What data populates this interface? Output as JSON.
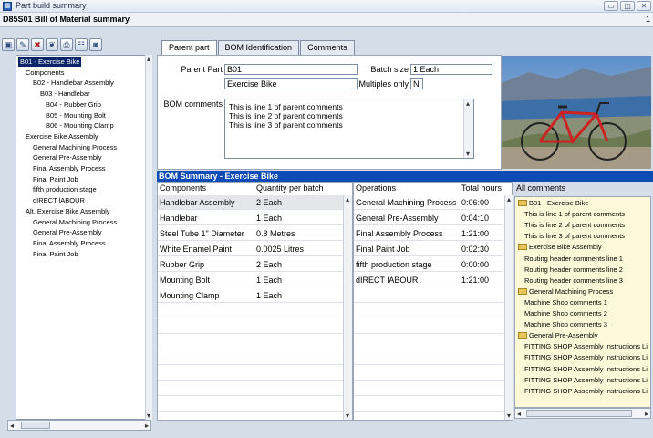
{
  "window": {
    "title": "Part build summary",
    "subtitle": "D85S01 Bill of Material summary",
    "page_number": "1"
  },
  "toolbar": {
    "icons": [
      "open-folder-icon",
      "edit-icon",
      "delete-icon",
      "tree-icon",
      "print-icon",
      "structure-icon",
      "photo-icon"
    ]
  },
  "tree": {
    "items": [
      {
        "label": "B01 - Exercise Bike",
        "selected": true
      },
      {
        "label": "Components"
      },
      {
        "label": "B02 - Handlebar Assembly"
      },
      {
        "label": "B03 - Handlebar"
      },
      {
        "label": "B04 - Rubber Grip"
      },
      {
        "label": "B05 - Mounting Bolt"
      },
      {
        "label": "B06 - Mounting Clamp"
      },
      {
        "label": "Exercise Bike Assembly"
      },
      {
        "label": "General Machining Process"
      },
      {
        "label": "General Pre-Assembly"
      },
      {
        "label": "Final Assembly Process"
      },
      {
        "label": "Final Paint Job"
      },
      {
        "label": "fifth production stage"
      },
      {
        "label": "dIRECT lABOUR"
      },
      {
        "label": "Alt. Exercise Bike Assembly"
      },
      {
        "label": "General Machining Process"
      },
      {
        "label": "General Pre-Assembly"
      },
      {
        "label": "Final Assembly Process"
      },
      {
        "label": "Final Paint Job"
      }
    ]
  },
  "tabs": [
    "Parent part",
    "BOM Identification",
    "Comments"
  ],
  "parent": {
    "parent_part_label": "Parent Part",
    "parent_part_value": "B01",
    "description": "Exercise Bike",
    "batch_size_label": "Batch size",
    "batch_size_value": "1 Each",
    "multiples_label": "Multiples only",
    "multiples_value": "N",
    "bom_comments_label": "BOM comments",
    "bom_comments": [
      "This is line 1 of parent comments",
      "This is line 2 of parent comments",
      "This is line 3 of parent comments"
    ]
  },
  "bom_summary": {
    "title": "BOM Summary -  Exercise Bike",
    "components_header": "Components",
    "qty_header": "Quantity per batch",
    "operations_header": "Operations",
    "hours_header": "Total hours",
    "all_comments_header": "All comments",
    "components": [
      {
        "name": "Handlebar Assembly",
        "qty": "2 Each"
      },
      {
        "name": "Handlebar",
        "qty": "1 Each"
      },
      {
        "name": "Steel Tube 1\" Diameter",
        "qty": "0.8 Metres"
      },
      {
        "name": "White Enamel Paint",
        "qty": "0.0025 Litres"
      },
      {
        "name": "Rubber Grip",
        "qty": "2 Each"
      },
      {
        "name": "Mounting Bolt",
        "qty": "1 Each"
      },
      {
        "name": "Mounting Clamp",
        "qty": "1 Each"
      }
    ],
    "operations": [
      {
        "name": "General Machining Process",
        "hours": "0:06:00"
      },
      {
        "name": "General Pre-Assembly",
        "hours": "0:04:10"
      },
      {
        "name": "Final Assembly Process",
        "hours": "1:21:00"
      },
      {
        "name": "Final Paint Job",
        "hours": "0:02:30"
      },
      {
        "name": "fifth production stage",
        "hours": "0:00:00"
      },
      {
        "name": "dIRECT lABOUR",
        "hours": "1:21:00"
      }
    ],
    "all_comments": [
      {
        "text": "B01 - Exercise Bike",
        "folder": true
      },
      {
        "text": "This is line 1 of parent comments"
      },
      {
        "text": "This is line 2 of parent comments"
      },
      {
        "text": "This is line 3 of parent comments"
      },
      {
        "text": "Exercise Bike Assembly",
        "folder": true
      },
      {
        "text": "Routing header comments line 1"
      },
      {
        "text": "Routing header comments line 2"
      },
      {
        "text": "Routing header comments line 3"
      },
      {
        "text": "General Machining Process",
        "folder": true
      },
      {
        "text": "Machine Shop comments 1"
      },
      {
        "text": "Machine Shop comments 2"
      },
      {
        "text": "Machine Shop comments 3"
      },
      {
        "text": "General Pre-Assembly",
        "folder": true
      },
      {
        "text": "FITTING SHOP Assembly Instructions Li"
      },
      {
        "text": "FITTING SHOP Assembly Instructions Li"
      },
      {
        "text": "FITTING SHOP Assembly Instructions Li"
      },
      {
        "text": "FITTING SHOP Assembly Instructions Li"
      },
      {
        "text": "FITTING SHOP Assembly Instructions Li"
      }
    ]
  },
  "colors": {
    "header_blue": "#0d4bb5",
    "selection": "#0a246a",
    "comments_bg": "#fdf9d8"
  }
}
